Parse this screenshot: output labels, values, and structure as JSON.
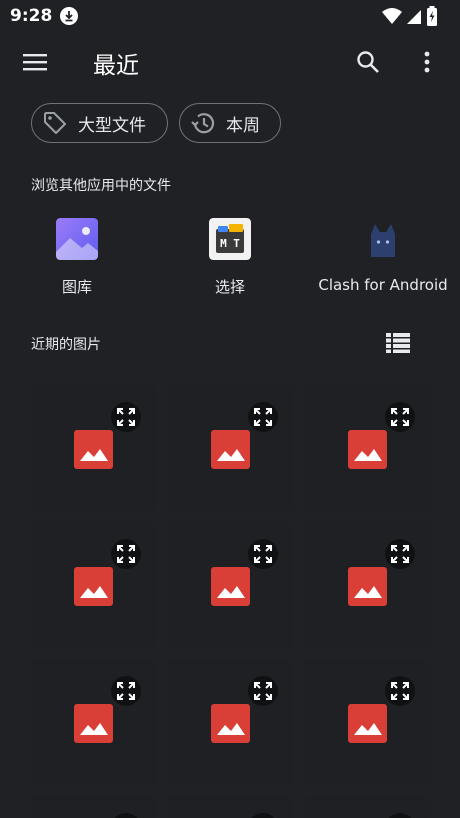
{
  "status": {
    "time": "9:28"
  },
  "app_bar": {
    "title": "最近"
  },
  "chips": [
    {
      "label": "大型文件",
      "icon": "tag-icon"
    },
    {
      "label": "本周",
      "icon": "history-icon"
    }
  ],
  "browse_section": {
    "label": "浏览其他应用中的文件",
    "apps": [
      {
        "label": "图库",
        "icon": "gallery-app-icon"
      },
      {
        "label": "选择",
        "icon": "mt-app-icon"
      },
      {
        "label": "Clash for Android",
        "icon": "clash-cat-icon"
      }
    ]
  },
  "recent_section": {
    "label": "近期的图片"
  },
  "colors": {
    "background": "#202124",
    "placeholder_red": "#d93f36",
    "gallery_purple": "#7b6df5"
  }
}
